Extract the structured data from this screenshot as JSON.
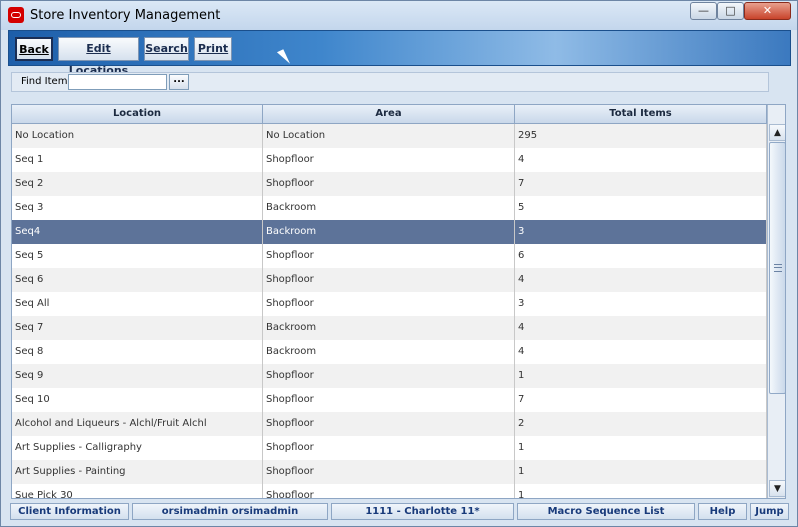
{
  "window": {
    "title": "Store Inventory Management",
    "controls": {
      "minimize": "—",
      "maximize": "□",
      "close": "✕"
    }
  },
  "toolbar": {
    "back_label": "Back",
    "edit_locations_label": "Edit Locations",
    "search_label": "Search",
    "print_label": "Print"
  },
  "find": {
    "label": "Find Item:",
    "value": "",
    "browse_label": "..."
  },
  "table": {
    "headers": [
      "Location",
      "Area",
      "Total Items"
    ],
    "rows": [
      {
        "location": "No Location",
        "area": "No Location",
        "total": "295"
      },
      {
        "location": "Seq 1",
        "area": "Shopfloor",
        "total": "4"
      },
      {
        "location": "Seq 2",
        "area": "Shopfloor",
        "total": "7"
      },
      {
        "location": "Seq 3",
        "area": "Backroom",
        "total": "5"
      },
      {
        "location": "Seq4",
        "area": "Backroom",
        "total": "3"
      },
      {
        "location": "Seq 5",
        "area": "Shopfloor",
        "total": "6"
      },
      {
        "location": "Seq 6",
        "area": "Shopfloor",
        "total": "4"
      },
      {
        "location": "Seq All",
        "area": "Shopfloor",
        "total": "3"
      },
      {
        "location": "Seq 7",
        "area": "Backroom",
        "total": "4"
      },
      {
        "location": "Seq 8",
        "area": "Backroom",
        "total": "4"
      },
      {
        "location": "Seq 9",
        "area": "Shopfloor",
        "total": "1"
      },
      {
        "location": "Seq 10",
        "area": "Shopfloor",
        "total": "7"
      },
      {
        "location": "Alcohol and Liqueurs - Alchl/Fruit Alchl",
        "area": "Shopfloor",
        "total": "2"
      },
      {
        "location": "Art Supplies - Calligraphy",
        "area": "Shopfloor",
        "total": "1"
      },
      {
        "location": "Art Supplies - Painting",
        "area": "Shopfloor",
        "total": "1"
      },
      {
        "location": "Sue Pick 30",
        "area": "Shopfloor",
        "total": "1"
      }
    ],
    "selected_row": 4
  },
  "scrollbar": {
    "up": "▲",
    "down": "▼"
  },
  "statusbar": {
    "client_info": "Client Information",
    "user": "orsimadmin orsimadmin",
    "store": "1111 - Charlotte 11*",
    "screen": "Macro Sequence List",
    "help": "Help",
    "jump": "Jump"
  },
  "colors": {
    "toolbar_blue": "#1d5ea9",
    "selected_row": "#5d7399",
    "status_text": "#183a7a",
    "close_red": "#c8432b"
  }
}
